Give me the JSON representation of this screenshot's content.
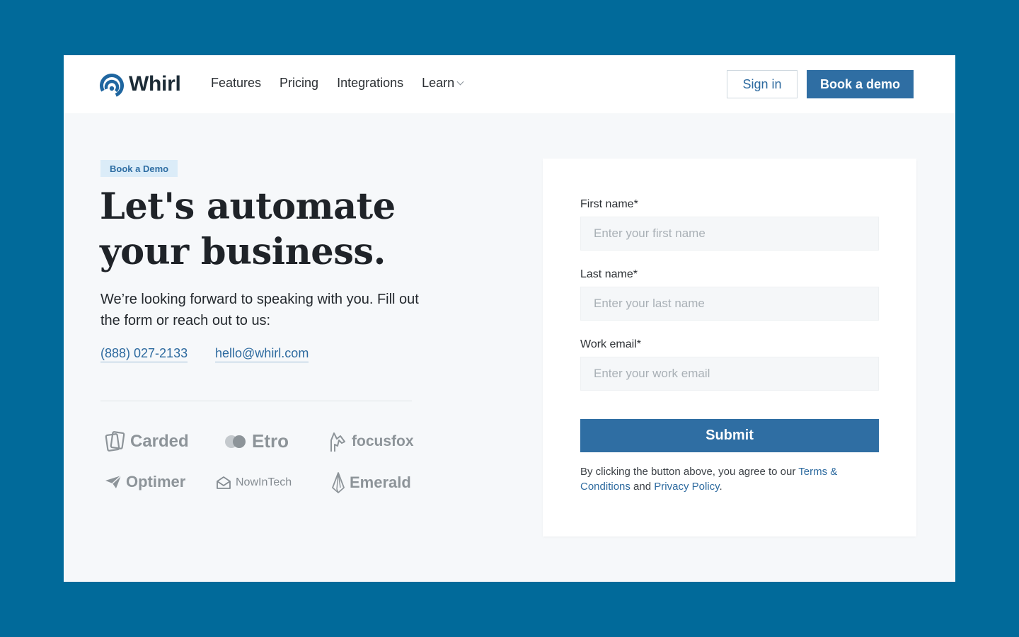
{
  "brand": {
    "name": "Whirl",
    "logo_icon": "whirl-logo-icon",
    "accent_color": "#2f6ea3",
    "background_color": "#016a9a"
  },
  "nav": {
    "items": [
      {
        "label": "Features"
      },
      {
        "label": "Pricing"
      },
      {
        "label": "Integrations"
      },
      {
        "label": "Learn",
        "icon": "chevron-down-icon"
      }
    ],
    "sign_in_label": "Sign in",
    "book_demo_label": "Book a demo"
  },
  "hero": {
    "badge": "Book a Demo",
    "headline_line1": "Let's automate",
    "headline_line2": "your business.",
    "lead": "We’re looking forward to speaking with you. Fill out the form or reach out to us:",
    "phone": "(888) 027-2133",
    "email": "hello@whirl.com"
  },
  "clients": [
    {
      "name": "Carded",
      "icon": "carded-logo-icon"
    },
    {
      "name": "Etro",
      "icon": "etro-logo-icon"
    },
    {
      "name": "focusfox",
      "icon": "focusfox-logo-icon"
    },
    {
      "name": "Optimer",
      "icon": "paper-plane-icon"
    },
    {
      "name": "NowInTech",
      "icon": "envelope-icon"
    },
    {
      "name": "Emerald",
      "icon": "emerald-gem-icon"
    }
  ],
  "form": {
    "first_name": {
      "label": "First name*",
      "placeholder": "Enter your first name",
      "value": ""
    },
    "last_name": {
      "label": "Last name*",
      "placeholder": "Enter your last name",
      "value": ""
    },
    "work_email": {
      "label": "Work email*",
      "placeholder": "Enter your work email",
      "value": ""
    },
    "submit_label": "Submit",
    "legal_prefix": "By clicking the button above, you agree to our ",
    "terms_label": "Terms & Conditions",
    "legal_and": " and ",
    "privacy_label": "Privacy Policy",
    "legal_suffix": "."
  }
}
